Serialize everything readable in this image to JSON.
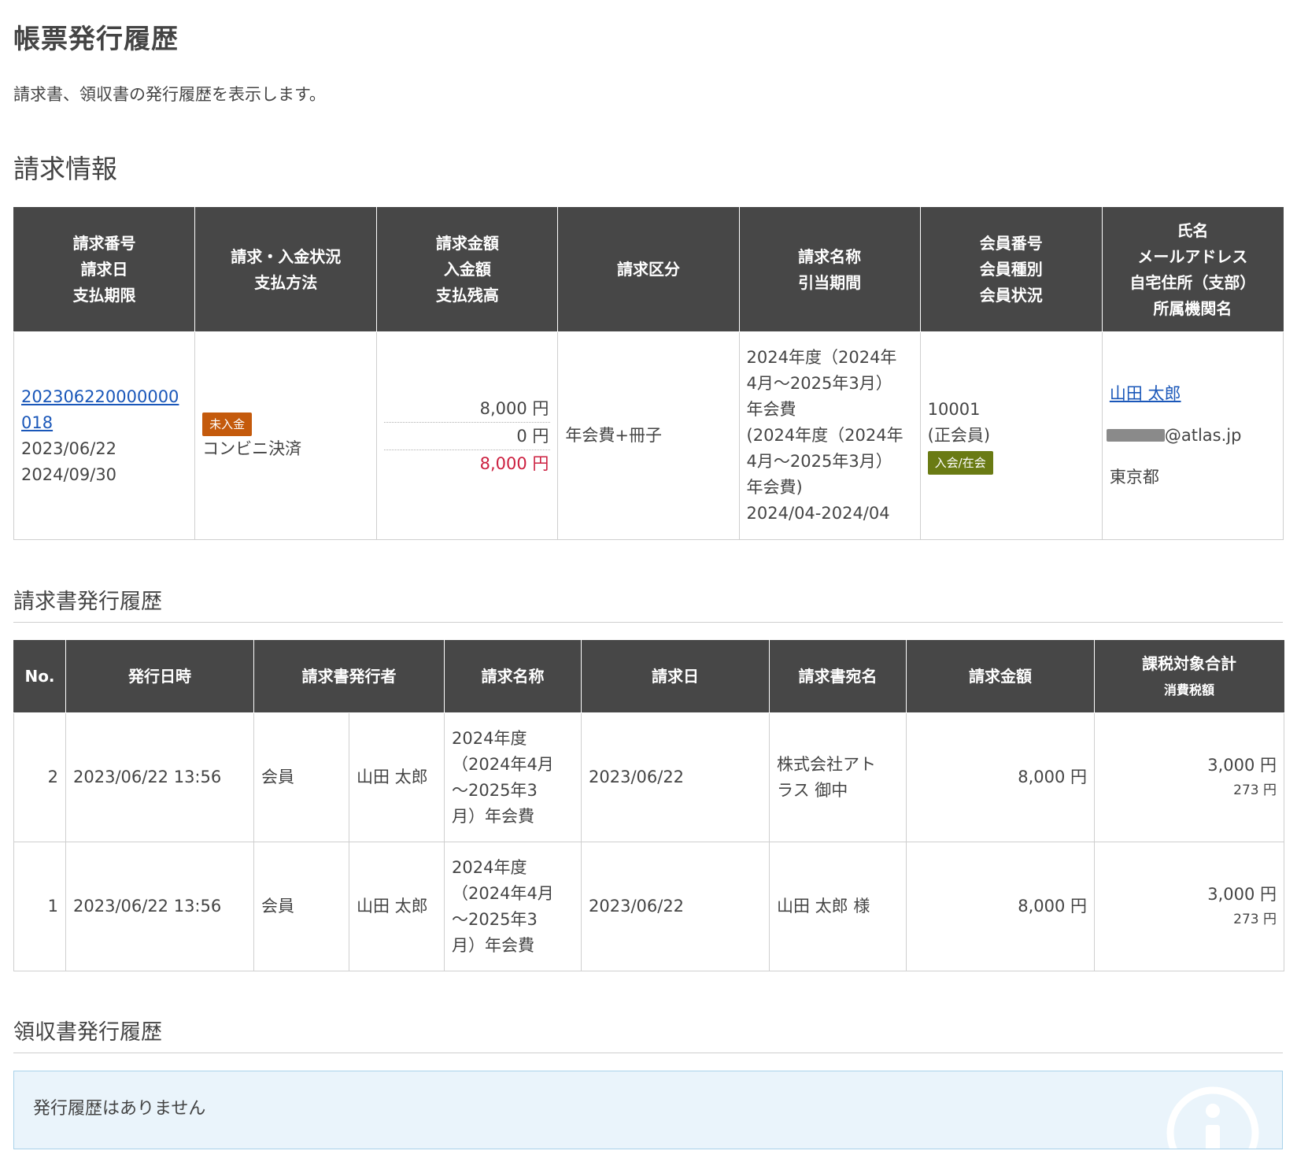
{
  "page": {
    "title": "帳票発行履歴",
    "description": "請求書、領収書の発行履歴を表示します。"
  },
  "billing": {
    "section_title": "請求情報",
    "headers": [
      [
        "請求番号",
        "請求日",
        "支払期限"
      ],
      [
        "請求・入金状況",
        "支払方法"
      ],
      [
        "請求金額",
        "入金額",
        "支払残高"
      ],
      [
        "請求区分"
      ],
      [
        "請求名称",
        "引当期間"
      ],
      [
        "会員番号",
        "会員種別",
        "会員状況"
      ],
      [
        "氏名",
        "メールアドレス",
        "自宅住所（支部）",
        "所属機関名"
      ]
    ],
    "row": {
      "invoice_no_line1": "202306220000000",
      "invoice_no_line2": "018",
      "invoice_date": "2023/06/22",
      "due_date": "2024/09/30",
      "status_badge": "未入金",
      "payment_method": "コンビニ決済",
      "billed_amount": "8,000 円",
      "paid_amount": "0 円",
      "balance": "8,000 円",
      "category": "年会費+冊子",
      "name_lines": [
        "2024年度（2024年",
        "4月～2025年3月）",
        "年会費",
        "(2024年度（2024年",
        "4月～2025年3月）",
        "年会費)"
      ],
      "period": "2024/04-2024/04",
      "member_no": "10001",
      "member_type": "(正会員)",
      "member_status_badge": "入会/在会",
      "person_name": "山田 太郎",
      "email_visible": "@atlas.jp",
      "address": "東京都"
    }
  },
  "invoice_history": {
    "section_title": "請求書発行履歴",
    "headers": {
      "no": "No.",
      "issued_at": "発行日時",
      "issuer": "請求書発行者",
      "billing_name": "請求名称",
      "billing_date": "請求日",
      "addressee": "請求書宛名",
      "amount": "請求金額",
      "taxable_total": "課税対象合計",
      "tax_amount": "消費税額"
    },
    "rows": [
      {
        "no": "2",
        "issued_at": "2023/06/22 13:56",
        "issuer_type": "会員",
        "issuer_name": "山田 太郎",
        "billing_name_lines": [
          "2024年度",
          "（2024年4月",
          "～2025年3",
          "月）年会費"
        ],
        "billing_date": "2023/06/22",
        "addressee_lines": [
          "株式会社アト",
          "ラス 御中"
        ],
        "amount": "8,000 円",
        "taxable_total": "3,000 円",
        "tax": "273 円"
      },
      {
        "no": "1",
        "issued_at": "2023/06/22 13:56",
        "issuer_type": "会員",
        "issuer_name": "山田 太郎",
        "billing_name_lines": [
          "2024年度",
          "（2024年4月",
          "～2025年3",
          "月）年会費"
        ],
        "billing_date": "2023/06/22",
        "addressee_lines": [
          "山田 太郎 様"
        ],
        "amount": "8,000 円",
        "taxable_total": "3,000 円",
        "tax": "273 円"
      }
    ]
  },
  "receipt_history": {
    "section_title": "領収書発行履歴",
    "empty_message": "発行履歴はありません",
    "icon": "info-icon"
  },
  "colors": {
    "header_bg": "#474747",
    "link": "#1a57b9",
    "unpaid_badge": "#c45a0c",
    "active_badge": "#6a7b14",
    "balance_red": "#cc1f3f",
    "info_bg": "#eaf4fb"
  }
}
